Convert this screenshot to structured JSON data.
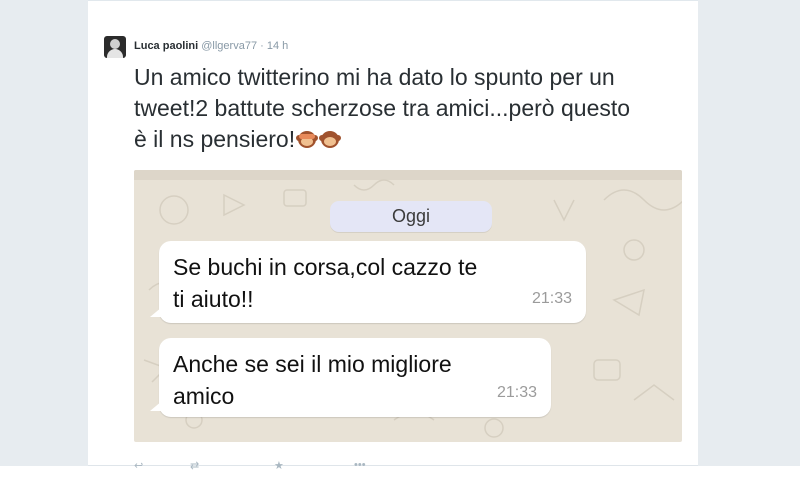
{
  "tweet": {
    "author_name": "Luca paolini",
    "author_handle": "@llgerva77",
    "separator": "·",
    "time": "14 h",
    "text": "Un amico twitterino mi ha dato lo spunto per un tweet!2 battute scherzose tra amici...però questo è il ns pensiero!",
    "emojis": [
      "see-no-evil-monkey-icon",
      "monkey-face-icon"
    ]
  },
  "chat": {
    "date_label": "Oggi",
    "messages": [
      {
        "text_line1": "Se buchi in corsa,col cazzo te",
        "text_line2": "ti aiuto!!",
        "time": "21:33"
      },
      {
        "text_line1": "Anche se sei il mio migliore",
        "text_line2": "amico",
        "time": "21:33"
      }
    ]
  },
  "actions": [
    "reply-icon",
    "retweet-icon",
    "favorite-icon",
    "more-icon"
  ],
  "colors": {
    "page_bg": "#e9eef2",
    "card_bg": "#ffffff",
    "text": "#292f33",
    "muted": "#8899a6",
    "chat_bg": "#e8e2d6",
    "date_pill": "#e4e6f6",
    "bubble": "#ffffff"
  }
}
